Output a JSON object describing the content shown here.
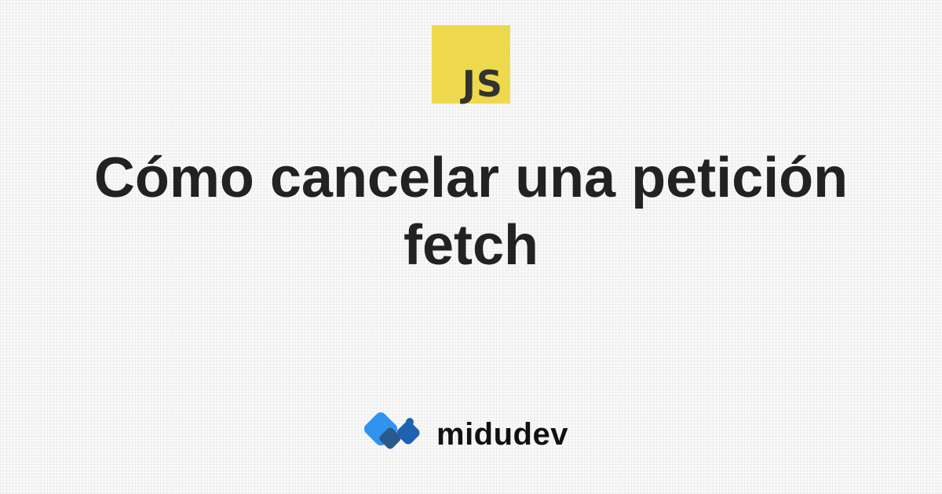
{
  "badge": {
    "text": "JS",
    "background": "#eed94c",
    "color": "#323330"
  },
  "title": "Cómo cancelar una petición fetch",
  "brand": {
    "name": "midudev",
    "logo_icon": "midudev-logo-icon",
    "colors": [
      "#2f93f0",
      "#1e63b0",
      "#285a8c"
    ]
  }
}
